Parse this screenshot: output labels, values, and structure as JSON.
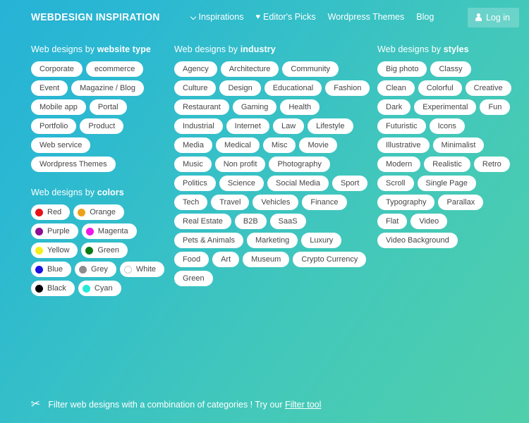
{
  "header": {
    "logo": "WEBDESIGN INSPIRATION",
    "nav": [
      {
        "label": "Inspirations",
        "icon": "chevron-down-icon"
      },
      {
        "label": "Editor's Picks",
        "icon": "heart-icon"
      },
      {
        "label": "Wordpress Themes",
        "icon": ""
      },
      {
        "label": "Blog",
        "icon": ""
      }
    ],
    "login_label": "Log in"
  },
  "theme": {
    "gradient_start": "#26b3d6",
    "gradient_end": "#50cfab",
    "pill_bg": "#ffffff",
    "pill_text": "#454545",
    "header_text": "#ffffff"
  },
  "sections": {
    "website_type": {
      "title_prefix": "Web designs by ",
      "title_bold": "website type",
      "tags": [
        "Corporate",
        "ecommerce",
        "Event",
        "Magazine / Blog",
        "Mobile app",
        "Portal",
        "Portfolio",
        "Product",
        "Web service",
        "Wordpress Themes"
      ]
    },
    "colors": {
      "title_prefix": "Web designs by ",
      "title_bold": "colors",
      "tags": [
        {
          "label": "Red",
          "color": "#e8121a"
        },
        {
          "label": "Orange",
          "color": "#eda11b"
        },
        {
          "label": "Purple",
          "color": "#8e0d92"
        },
        {
          "label": "Magenta",
          "color": "#f018e8"
        },
        {
          "label": "Yellow",
          "color": "#f6ef1a"
        },
        {
          "label": "Green",
          "color": "#0a7a14"
        },
        {
          "label": "Blue",
          "color": "#1811e0"
        },
        {
          "label": "Grey",
          "color": "#8d8d8d"
        },
        {
          "label": "White",
          "color": "#ffffff"
        },
        {
          "label": "Black",
          "color": "#000000"
        },
        {
          "label": "Cyan",
          "color": "#26ead8"
        }
      ]
    },
    "industry": {
      "title_prefix": "Web designs by ",
      "title_bold": "industry",
      "tags": [
        "Agency",
        "Architecture",
        "Community",
        "Culture",
        "Design",
        "Educational",
        "Fashion",
        "Restaurant",
        "Gaming",
        "Health",
        "Industrial",
        "Internet",
        "Law",
        "Lifestyle",
        "Media",
        "Medical",
        "Misc",
        "Movie",
        "Music",
        "Non profit",
        "Photography",
        "Politics",
        "Science",
        "Social Media",
        "Sport",
        "Tech",
        "Travel",
        "Vehicles",
        "Finance",
        "Real Estate",
        "B2B",
        "SaaS",
        "Pets & Animals",
        "Marketing",
        "Luxury",
        "Food",
        "Art",
        "Museum",
        "Crypto Currency",
        "Green"
      ]
    },
    "styles": {
      "title_prefix": "Web designs by ",
      "title_bold": "styles",
      "tags": [
        "Big photo",
        "Classy",
        "Clean",
        "Colorful",
        "Creative",
        "Dark",
        "Experimental",
        "Fun",
        "Futuristic",
        "Icons",
        "Illustrative",
        "Minimalist",
        "Modern",
        "Realistic",
        "Retro",
        "Scroll",
        "Single Page",
        "Typography",
        "Parallax",
        "Flat",
        "Video",
        "Video Background"
      ]
    }
  },
  "footer": {
    "icon": "scissors-icon",
    "text": "Filter web designs with a combination of categories ! Try our ",
    "link": "Filter tool"
  }
}
